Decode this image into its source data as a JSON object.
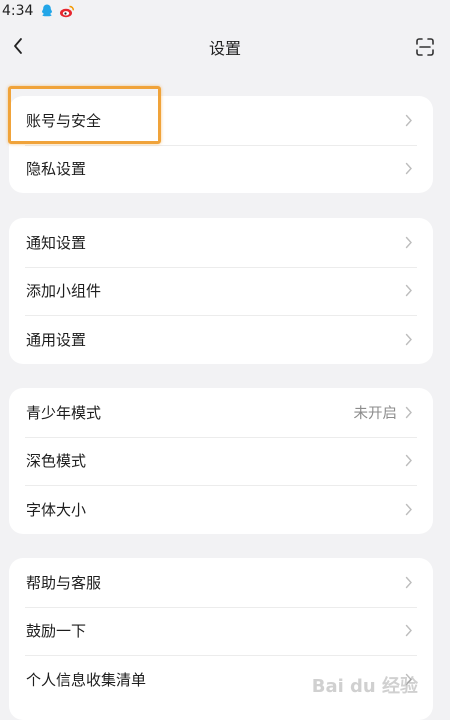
{
  "status_bar": {
    "time": "4:34"
  },
  "nav": {
    "title": "设置"
  },
  "groups": [
    {
      "items": [
        {
          "label": "账号与安全",
          "value": ""
        },
        {
          "label": "隐私设置",
          "value": ""
        }
      ]
    },
    {
      "items": [
        {
          "label": "通知设置",
          "value": ""
        },
        {
          "label": "添加小组件",
          "value": ""
        },
        {
          "label": "通用设置",
          "value": ""
        }
      ]
    },
    {
      "items": [
        {
          "label": "青少年模式",
          "value": "未开启"
        },
        {
          "label": "深色模式",
          "value": ""
        },
        {
          "label": "字体大小",
          "value": ""
        }
      ]
    },
    {
      "items": [
        {
          "label": "帮助与客服",
          "value": ""
        },
        {
          "label": "鼓励一下",
          "value": ""
        },
        {
          "label": "个人信息收集清单",
          "value": ""
        }
      ]
    }
  ],
  "watermark": {
    "text": "Bai du 经验"
  },
  "colors": {
    "highlight": "#f0a33a",
    "background": "#f2f2f4"
  }
}
